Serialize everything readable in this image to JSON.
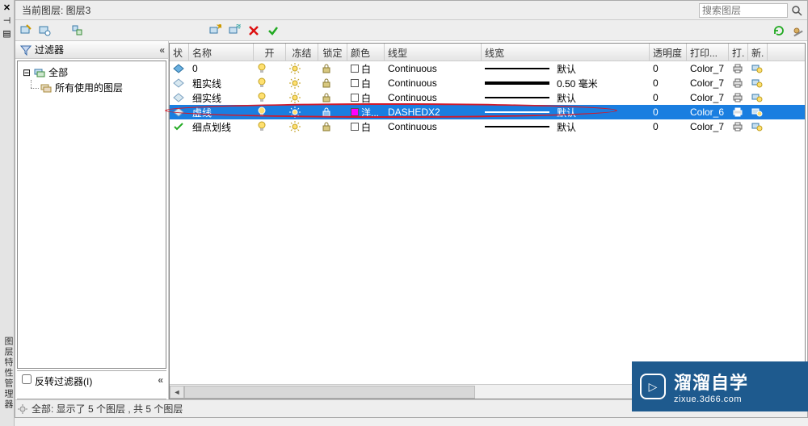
{
  "header": {
    "current_layer_label": "当前图层: 图层3",
    "search_placeholder": "搜索图层"
  },
  "filter": {
    "title": "过滤器",
    "collapse": "«",
    "tree": {
      "root": "全部",
      "child": "所有使用的图层"
    },
    "invert_label": "反转过滤器(I)",
    "invert_collapse": "«"
  },
  "columns": {
    "status": "状",
    "name": "名称",
    "on": "开",
    "freeze": "冻结",
    "lock": "锁定",
    "color": "颜色",
    "linetype": "线型",
    "lineweight": "线宽",
    "transparency": "透明度",
    "plotstyle": "打印...",
    "plot": "打.",
    "new": "新."
  },
  "rows": [
    {
      "status": "current",
      "name": "0",
      "color": "白",
      "swatch": "#ffffff",
      "linetype": "Continuous",
      "lineweight": "默认",
      "lw_style": "thin",
      "trans": "0",
      "plotstyle": "Color_7"
    },
    {
      "status": "layer",
      "name": "粗实线",
      "color": "白",
      "swatch": "#ffffff",
      "linetype": "Continuous",
      "lineweight": "0.50 毫米",
      "lw_style": "thick",
      "trans": "0",
      "plotstyle": "Color_7"
    },
    {
      "status": "layer",
      "name": "细实线",
      "color": "白",
      "swatch": "#ffffff",
      "linetype": "Continuous",
      "lineweight": "默认",
      "lw_style": "thin",
      "trans": "0",
      "plotstyle": "Color_7"
    },
    {
      "status": "selected",
      "name": "虚线",
      "color": "洋...",
      "swatch": "#ff00ff",
      "linetype": "DASHEDX2",
      "lineweight": "默认",
      "lw_style": "dash",
      "trans": "0",
      "plotstyle": "Color_6"
    },
    {
      "status": "check",
      "name": "细点划线",
      "color": "白",
      "swatch": "#ffffff",
      "linetype": "Continuous",
      "lineweight": "默认",
      "lw_style": "thin",
      "trans": "0",
      "plotstyle": "Color_7"
    }
  ],
  "status_bar": "全部: 显示了 5 个图层 , 共 5 个图层",
  "watermark": {
    "brand": "溜溜自学",
    "url": "zixue.3d66.com"
  },
  "leftstrip": {
    "vlabel": "图层特性管理器"
  }
}
